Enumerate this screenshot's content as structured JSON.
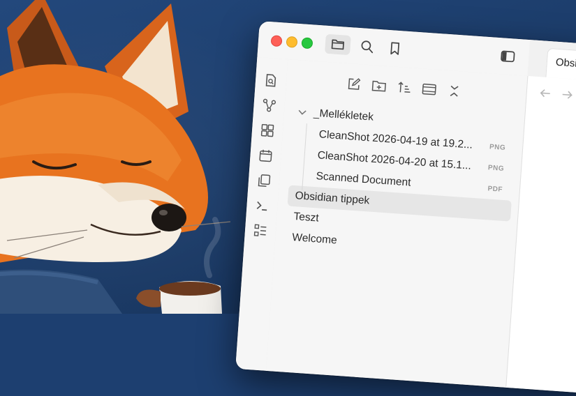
{
  "window": {
    "toolbar": [
      {
        "icon": "folder-icon",
        "active": true
      },
      {
        "icon": "search-icon"
      },
      {
        "icon": "bookmark-icon"
      }
    ],
    "sidebar_toggle_icon": "sidebar-toggle-icon"
  },
  "ribbon": [
    "quick-switcher-icon",
    "graph-view-icon",
    "canvas-icon",
    "daily-note-icon",
    "templates-icon",
    "command-palette-icon",
    "outline-icon"
  ],
  "explorer": {
    "nav_buttons": [
      "new-note-icon",
      "new-folder-icon",
      "sort-icon",
      "auto-reveal-icon",
      "collapse-all-icon"
    ],
    "tree": {
      "folder": {
        "label": "_Mellékletek",
        "expanded": true
      },
      "children": [
        {
          "label": "CleanShot 2026-04-19 at 19.2...",
          "ext": "PNG"
        },
        {
          "label": "CleanShot 2026-04-20 at 15.1...",
          "ext": "PNG"
        },
        {
          "label": "Scanned Document",
          "ext": "PDF"
        }
      ],
      "top_level": [
        {
          "label": "Obsidian tippek",
          "selected": true
        },
        {
          "label": "Teszt"
        },
        {
          "label": "Welcome"
        }
      ]
    }
  },
  "editor": {
    "tab_label": "Obsidian"
  },
  "colors": {
    "background": "#1d3f70",
    "fox_orange": "#e8731f",
    "traffic_red": "#fe5f57",
    "traffic_yellow": "#febc2e",
    "traffic_green": "#28c840"
  }
}
